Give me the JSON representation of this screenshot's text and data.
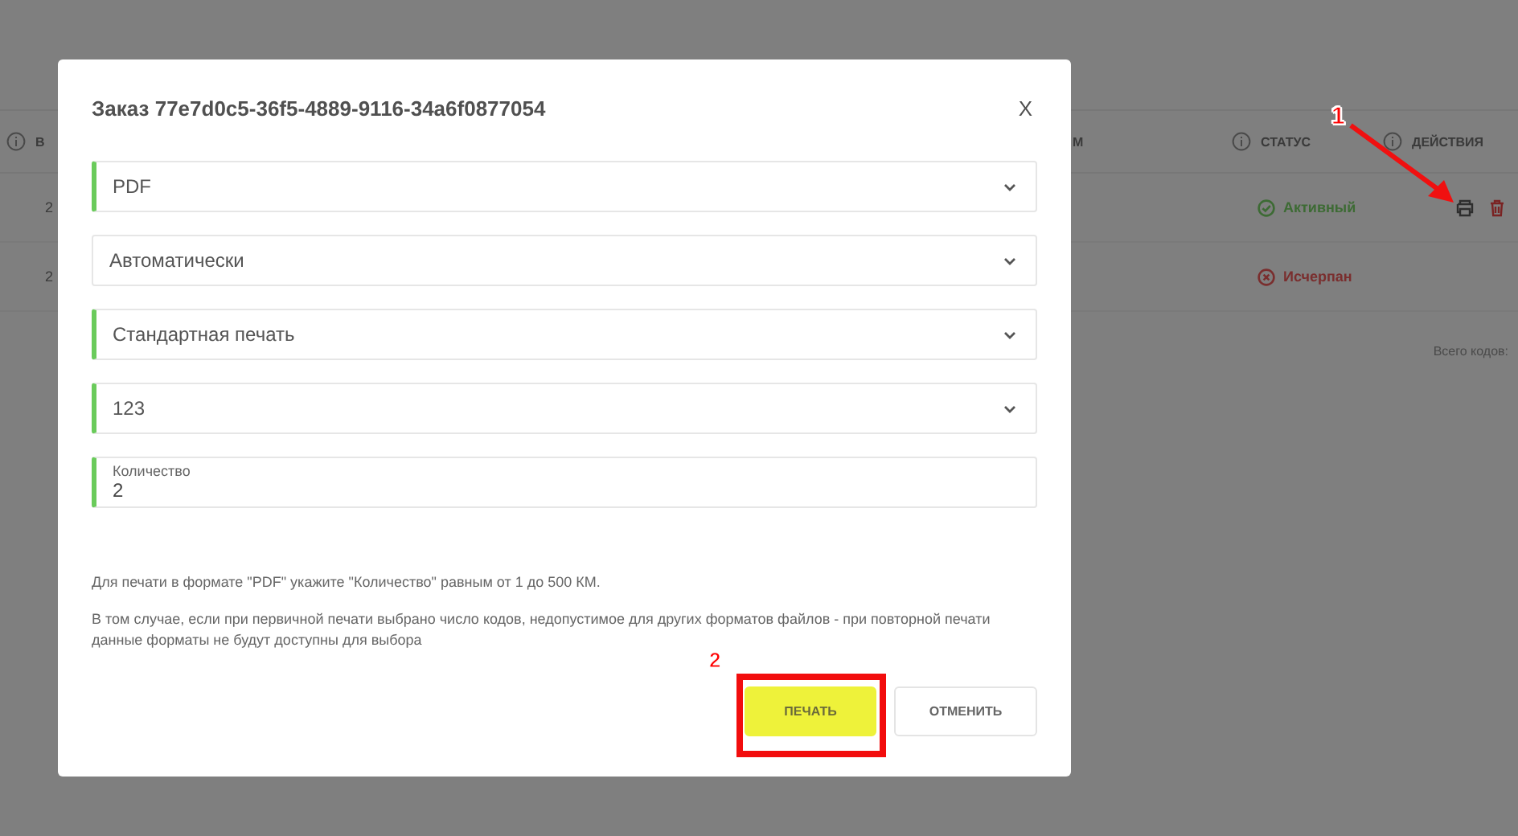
{
  "background_table": {
    "columns": [
      {
        "label": "В",
        "info_icon": true
      },
      {
        "label": "М",
        "info_icon": false
      },
      {
        "label": "СТАТУС",
        "info_icon": true
      },
      {
        "label": "ДЕЙСТВИЯ",
        "info_icon": true
      }
    ],
    "rows": [
      {
        "column_1": "2",
        "status": "Активный",
        "kind": "active",
        "has_actions": true
      },
      {
        "column_1": "2",
        "status": "Исчерпан",
        "kind": "exhausted",
        "has_actions": false
      }
    ],
    "footer": "Всего кодов:"
  },
  "dialog": {
    "title": "Заказ 77e7d0c5-36f5-4889-9116-34a6f0877054",
    "close": "X",
    "fields": [
      {
        "kind": "select",
        "value": "PDF",
        "marked": true
      },
      {
        "kind": "select",
        "value": "Автоматически",
        "marked": false
      },
      {
        "kind": "select",
        "value": "Стандартная печать",
        "marked": true
      },
      {
        "kind": "select",
        "value": "123",
        "marked": true
      },
      {
        "kind": "input",
        "label": "Количество",
        "value": "2",
        "marked": true
      }
    ],
    "notes": [
      "Для печати в формате \"PDF\" укажите \"Количество\" равным от 1 до 500 КМ.",
      "В том случае, если при первичной печати выбрано число кодов, недопустимое для других форматов файлов - при повторной печати данные форматы не будут доступны для выбора"
    ],
    "buttons": [
      {
        "label": "ПЕЧАТЬ",
        "kind": "primary"
      },
      {
        "label": "ОТМЕНИТЬ",
        "kind": "secondary"
      }
    ]
  },
  "annotations": [
    {
      "label": "1",
      "kind": "arrow"
    },
    {
      "label": "2",
      "kind": "frame"
    }
  ]
}
